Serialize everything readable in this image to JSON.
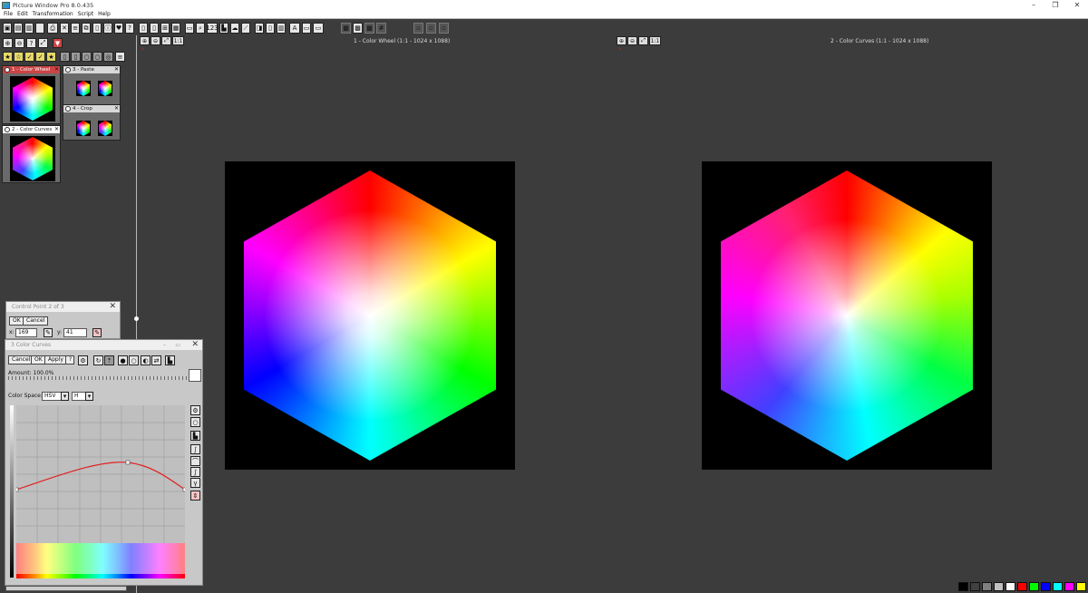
{
  "app": {
    "title": "Picture Window Pro 8.0.435"
  },
  "menu": [
    "File",
    "Edit",
    "Transformation",
    "Script",
    "Help"
  ],
  "views": [
    {
      "header": "1 - Color Wheel (1:1 - 1024 x 1088)",
      "zoom_label": "1:1"
    },
    {
      "header": "2 - Color Curves (1:1 - 1024 x 1088)",
      "zoom_label": "1:1"
    }
  ],
  "sidebar": {
    "thumbs": [
      {
        "label": "1 - Color Wheel"
      },
      {
        "label": "3 - Paste"
      },
      {
        "label": "4 - Crop"
      },
      {
        "label": "2 - Color Curves"
      }
    ]
  },
  "control_point_dialog": {
    "title": "Control Point 2 of 3",
    "ok": "OK",
    "cancel": "Cancel",
    "x_label": "x:",
    "x_value": "169",
    "y_label": "y:",
    "y_value": "41"
  },
  "color_curves_dialog": {
    "title": "3 Color Curves",
    "cancel": "Cancel",
    "ok": "OK",
    "apply": "Apply",
    "help": "?",
    "amount_label": "Amount: 100.0%",
    "color_space_label": "Color Space:",
    "color_space_value": "HSV",
    "channel_value": "H"
  },
  "palette": {
    "swatches": [
      "#000000",
      "#404040",
      "#808080",
      "#c0c0c0",
      "#ffffff",
      "#ff0000",
      "#00ff00",
      "#0000ff",
      "#00ffff",
      "#ff00ff",
      "#ffff00"
    ]
  }
}
